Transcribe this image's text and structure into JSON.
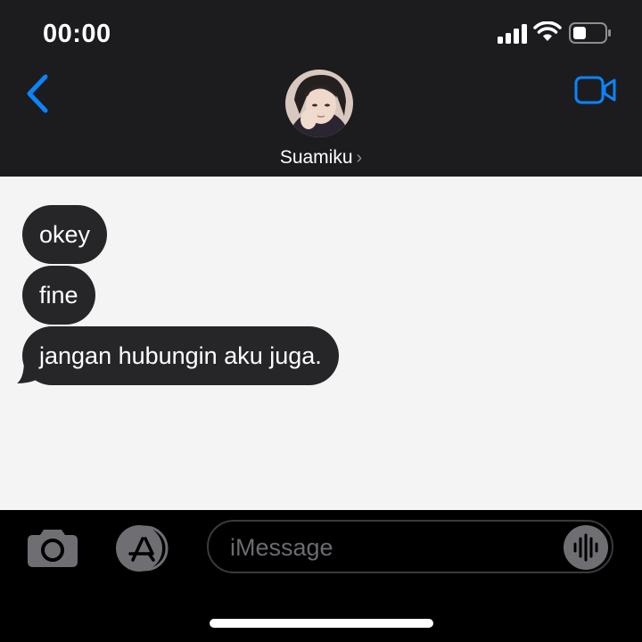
{
  "status_bar": {
    "time": "00:00",
    "icons": [
      "signal-icon",
      "wifi-icon",
      "battery-icon"
    ]
  },
  "nav": {
    "back_icon": "chevron-left-icon",
    "video_icon": "video-camera-icon",
    "contact_name": "Suamiku",
    "contact_chevron": "›"
  },
  "messages": [
    {
      "direction": "received",
      "text": "okey"
    },
    {
      "direction": "received",
      "text": "fine"
    },
    {
      "direction": "received",
      "text": "jangan hubungin aku juga."
    }
  ],
  "input_bar": {
    "placeholder": "iMessage",
    "icons": [
      "camera-icon",
      "app-store-icon",
      "audio-waveform-icon"
    ]
  },
  "colors": {
    "accent": "#0a84ff",
    "header_bg": "#1c1c1e",
    "conversation_bg": "#f4f4f4",
    "bubble_bg": "#262628",
    "input_bar_bg": "#000000"
  }
}
